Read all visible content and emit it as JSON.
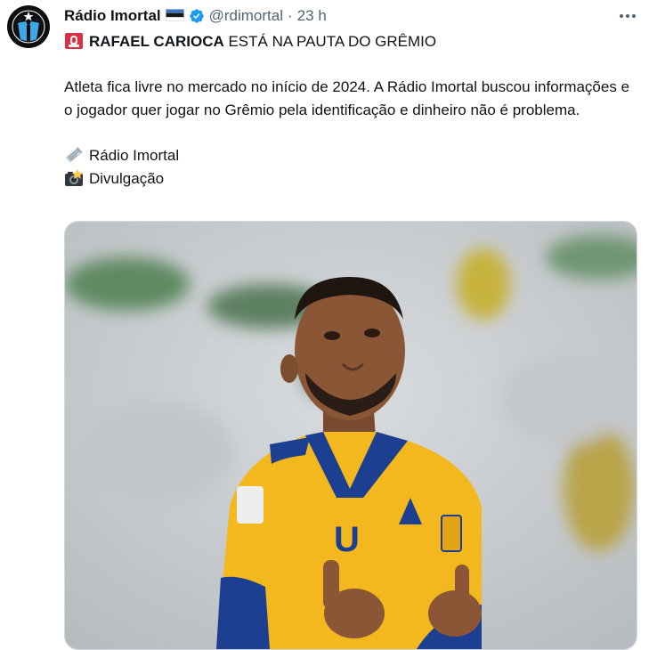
{
  "tweet": {
    "author_name": "Rádio Imortal",
    "handle": "@rdimortal",
    "separator": "·",
    "time": "23 h",
    "headline_bold": "RAFAEL CARIOCA",
    "headline_rest": " ESTÁ NA PAUTA DO GRÊMIO",
    "paragraph": "Atleta fica livre no mercado no início de 2024. A Rádio Imortal buscou informações e o jogador quer jogar no Grêmio pela identificação e dinheiro não é problema.",
    "credit_1": "Rádio Imortal",
    "credit_2": "Divulgação",
    "icons": {
      "headline_emoji": "siren-emoji",
      "credit_1_emoji": "newspaper-emoji",
      "credit_2_emoji": "camera-flash-emoji"
    },
    "colors": {
      "verified": "#1d9bf0",
      "secondary_text": "#536471",
      "jersey_yellow": "#f2b81e",
      "jersey_blue": "#1d3f91"
    }
  }
}
